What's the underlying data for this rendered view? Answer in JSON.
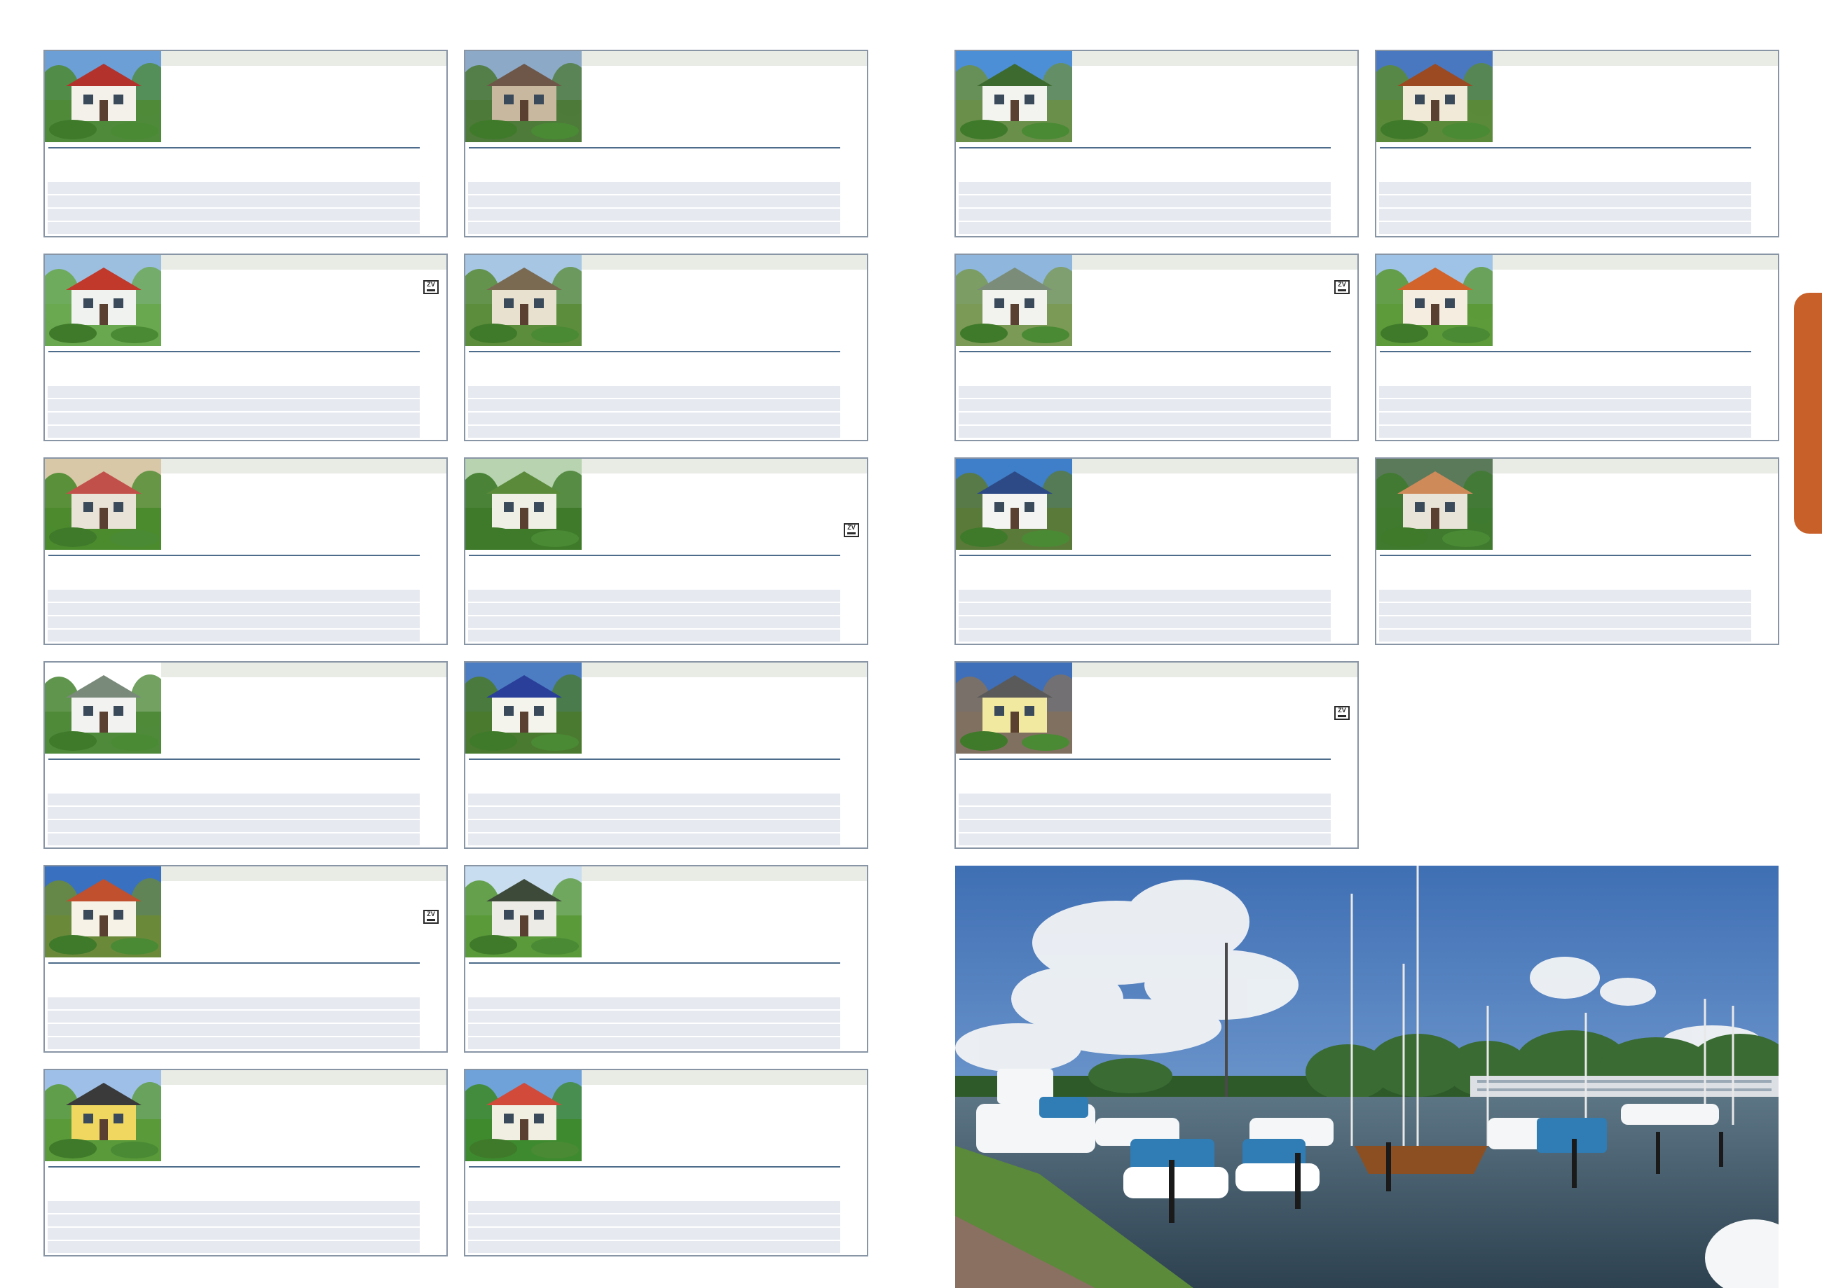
{
  "page": {
    "accent_color": "#c8602a",
    "card_border_color": "#8895a5",
    "header_band_color": "#e9ebe5",
    "row_color": "#e6e9ef"
  },
  "listings": [
    {
      "photo": "house-with-garden",
      "badge": ""
    },
    {
      "photo": "brick-path-building",
      "badge": ""
    },
    {
      "photo": "white-house-palm",
      "badge": ""
    },
    {
      "photo": "brown-roof-apartments",
      "badge": ""
    },
    {
      "photo": "green-shutter-house",
      "badge": "ZV"
    },
    {
      "photo": "thatched-cottage",
      "badge": ""
    },
    {
      "photo": "bungalow-stone-garden",
      "badge": "ZV"
    },
    {
      "photo": "red-roof-apartments",
      "badge": ""
    },
    {
      "photo": "flower-garden",
      "badge": ""
    },
    {
      "photo": "meadow-under-tree",
      "badge": "ZV"
    },
    {
      "photo": "house-with-tree",
      "badge": ""
    },
    {
      "photo": "terrace-with-chairs",
      "badge": ""
    },
    {
      "photo": "bungalow-with-hedge",
      "badge": ""
    },
    {
      "photo": "blue-roof-house",
      "badge": ""
    },
    {
      "photo": "painted-bungalow",
      "badge": "ZV"
    },
    {
      "photo": "red-roof-cottage",
      "badge": "ZV"
    },
    {
      "photo": "bungalow-flower-garden",
      "badge": ""
    },
    {
      "photo": "yellow-house",
      "badge": ""
    },
    {
      "photo": "house-among-trees",
      "badge": ""
    }
  ],
  "harbour_photo": "marina-with-sailboats"
}
